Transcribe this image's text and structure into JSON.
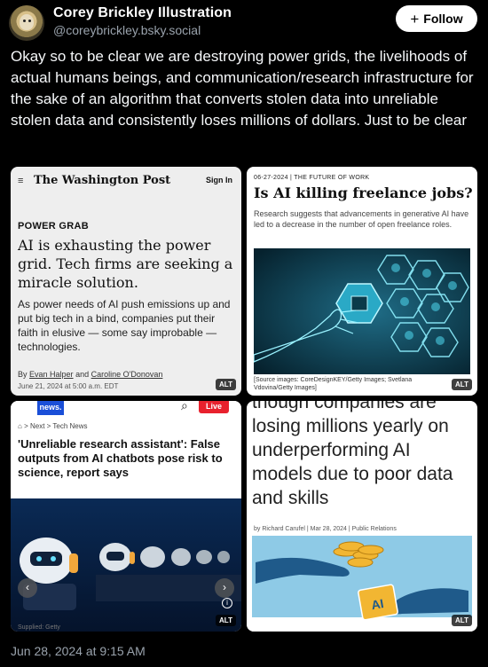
{
  "author": {
    "name": "Corey Brickley Illustration",
    "handle": "@coreybrickley.bsky.social"
  },
  "follow_button": {
    "icon": "plus-icon",
    "label": "Follow"
  },
  "post_text": "Okay so to be clear we are destroying power grids, the livelihoods of actual humans beings, and communication/research infrastructure for the sake of an algorithm that converts stolen data into unreliable stolen data and consistently loses millions of dollars. Just to be clear",
  "media": {
    "alt_badge": "ALT",
    "tile1": {
      "menu_icon": "≡",
      "logo": "The Washington Post",
      "sign_in": "Sign In",
      "kicker": "POWER GRAB",
      "headline": "AI is exhausting the power grid. Tech firms are seeking a miracle solution.",
      "dek": "As power needs of AI push emissions up and put big tech in a bind, companies put their faith in elusive — some say improbable — technologies.",
      "byline_prefix": "By",
      "author1": "Evan Halper",
      "byline_and": "and",
      "author2": "Caroline O'Donovan",
      "date": "June 21, 2024 at 5:00 a.m. EDT"
    },
    "tile2": {
      "meta": "06-27-2024 | THE FUTURE OF WORK",
      "headline": "Is AI killing freelance jobs?",
      "dek": "Research suggests that advancements in generative AI have led to a decrease in the number of open freelance roles.",
      "credit": "[Source images: CoreDesignKEY/Getty Images; Svetlana Vdovina/Getty Images]"
    },
    "tile3": {
      "logo": "news.",
      "live": "Live",
      "breadcrumb": "Next  >  Tech News",
      "headline": "'Unreliable research assistant': False outputs from AI chatbots pose risk to science, report says",
      "prev": "‹",
      "next": "›",
      "info": "i",
      "caption": "Supplied: Getty"
    },
    "tile4": {
      "text": "though companies are losing millions yearly on underperforming AI models due to poor data and skills",
      "byline": "by Richard Carufel | Mar 28, 2024 | Public Relations"
    }
  },
  "timestamp": "Jun 28, 2024 at 9:15 AM"
}
